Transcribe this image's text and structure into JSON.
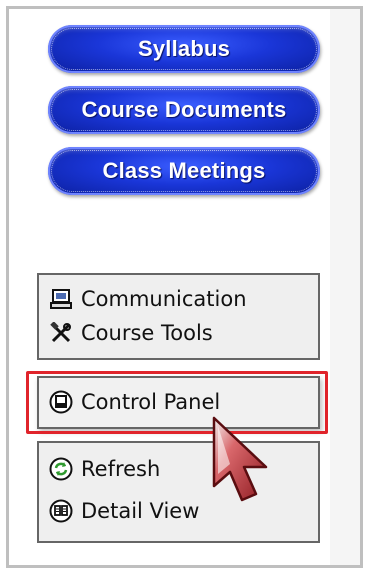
{
  "nav_buttons": [
    {
      "label": "Syllabus"
    },
    {
      "label": "Course Documents"
    },
    {
      "label": "Class Meetings"
    }
  ],
  "tools_panel": {
    "items": [
      {
        "label": "Communication",
        "icon": "computer-icon"
      },
      {
        "label": "Course Tools",
        "icon": "tools-icon"
      }
    ]
  },
  "control_panel": {
    "label": "Control Panel",
    "icon": "control-panel-icon"
  },
  "view_panel": {
    "items": [
      {
        "label": "Refresh",
        "icon": "refresh-icon"
      },
      {
        "label": "Detail View",
        "icon": "detail-view-icon"
      }
    ]
  },
  "colors": {
    "button_blue": "#1a36d8",
    "highlight_red": "#e0242b",
    "cursor_red": "#b3262c",
    "refresh_green": "#2f9a2f"
  }
}
